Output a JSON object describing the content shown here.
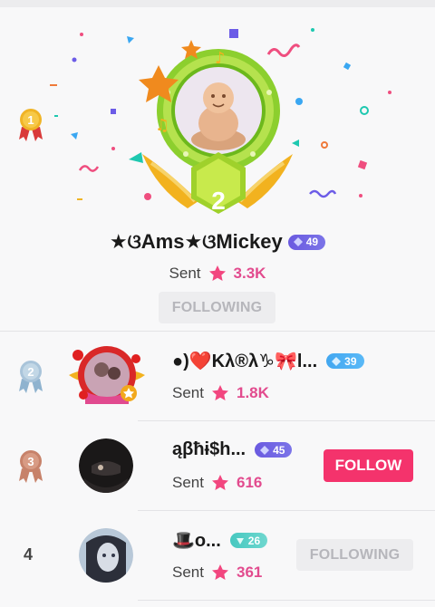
{
  "top": {
    "rank": "1",
    "level_number": "2",
    "name": "★ଓ‌Ams★ଓ‌Mickey",
    "level": "49",
    "sent_label": "Sent",
    "sent_value": "3.3K",
    "button_label": "FOLLOWING"
  },
  "rows": [
    {
      "rank": "2",
      "name": "●)❤️Kλ®λ♑🎀l...",
      "level": "39",
      "sent_label": "Sent",
      "sent_value": "1.8K",
      "button_label": ""
    },
    {
      "rank": "3",
      "name": "ąβħɨ$h...",
      "level": "45",
      "sent_label": "Sent",
      "sent_value": "616",
      "button_label": "FOLLOW"
    },
    {
      "rank": "4",
      "name": "🎩o...",
      "level": "26",
      "sent_label": "Sent",
      "sent_value": "361",
      "button_label": "FOLLOWING"
    }
  ],
  "colors": {
    "accent_pink": "#e24b8e",
    "follow_button": "#f4336c",
    "gold": "#f0b426",
    "silver": "#8fb3cf",
    "bronze": "#c7826a"
  }
}
